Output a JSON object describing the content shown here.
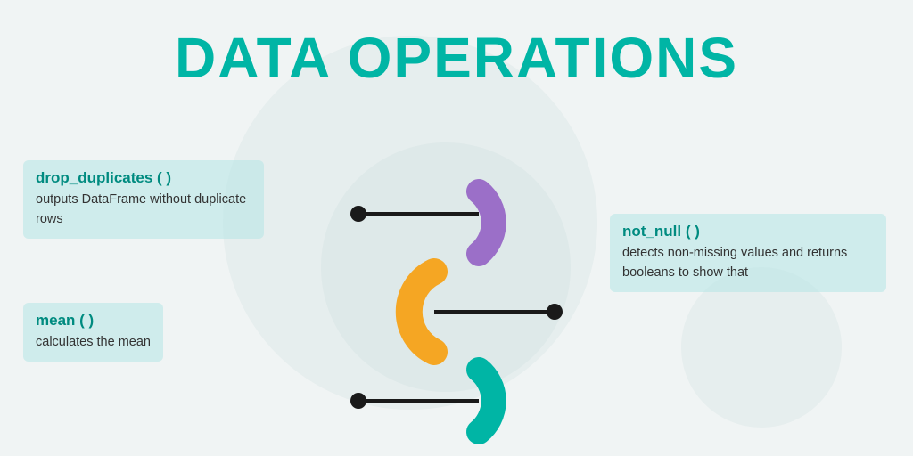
{
  "page": {
    "title": "DATA OPERATIONS",
    "bg_color": "#f0f4f4",
    "accent_color": "#00b5a5"
  },
  "cards": {
    "drop_duplicates": {
      "title": "drop_duplicates ( )",
      "description": "outputs  DataFrame  without duplicate rows"
    },
    "mean": {
      "title": "mean ( )",
      "description": "calculates the mean"
    },
    "not_null": {
      "title": "not_null ( )",
      "description": "detects  non-missing  values and  returns  booleans  to show that"
    }
  },
  "diagram": {
    "colors": {
      "purple": "#9b6fc8",
      "orange": "#f5a623",
      "teal": "#00b5a5"
    }
  }
}
